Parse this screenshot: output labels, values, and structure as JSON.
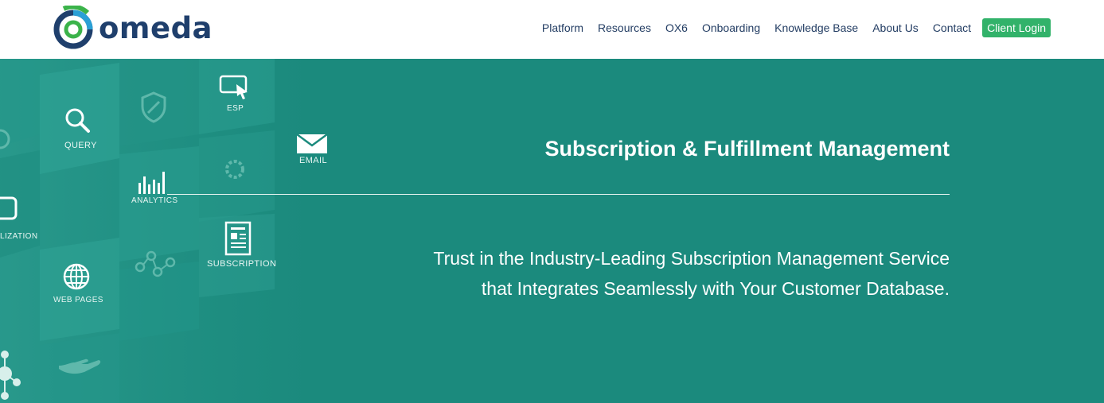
{
  "header": {
    "logo_text": "omeda",
    "nav": [
      "Platform",
      "Resources",
      "OX6",
      "Onboarding",
      "Knowledge Base",
      "About Us",
      "Contact"
    ],
    "login_label": "Client Login"
  },
  "hero": {
    "title": "Subscription & Fulfillment Management",
    "subtitle_line1": "Trust in the Industry-Leading Subscription Management Service",
    "subtitle_line2": "that Integrates Seamlessly with Your Customer Database.",
    "tiles": {
      "query": "QUERY",
      "esp": "ESP",
      "email": "EMAIL",
      "analytics": "ANALYTICS",
      "personalization": "LIZATION",
      "subscription": "SUBSCRIPTION",
      "web_pages": "WEB PAGES"
    }
  },
  "colors": {
    "hero_bg": "#1b8a7d",
    "nav_text": "#233d63",
    "login_bg": "#32b26a",
    "logo_text": "#1f3f6c"
  }
}
